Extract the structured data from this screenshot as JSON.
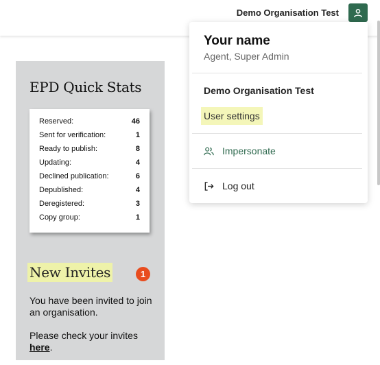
{
  "header": {
    "organisation": "Demo Organisation Test",
    "avatar_icon": "user-icon"
  },
  "stats": {
    "title": "EPD Quick Stats",
    "rows": [
      {
        "label": "Reserved:",
        "value": "46"
      },
      {
        "label": "Sent for verification:",
        "value": "1"
      },
      {
        "label": "Ready to publish:",
        "value": "8"
      },
      {
        "label": "Updating:",
        "value": "4"
      },
      {
        "label": "Declined publication:",
        "value": "6"
      },
      {
        "label": "Depublished:",
        "value": "4"
      },
      {
        "label": "Deregistered:",
        "value": "3"
      },
      {
        "label": "Copy group:",
        "value": "1"
      }
    ]
  },
  "invites": {
    "title": "New Invites",
    "count": "1",
    "message": "You have been invited to join an organisation.",
    "check_prefix": "Please check your invites",
    "link_text": "here",
    "check_suffix": "."
  },
  "menu": {
    "name": "Your name",
    "role": "Agent, Super Admin",
    "organisation": "Demo Organisation Test",
    "settings_label": "User settings",
    "impersonate_label": "Impersonate",
    "impersonate_icon": "users-icon",
    "logout_label": "Log out",
    "logout_icon": "logout-icon"
  },
  "colors": {
    "brand_green": "#2f6a4f",
    "badge_orange": "#e84c1e",
    "highlight_yellow": "#f4f6b9",
    "panel_gray": "#d6d7d8"
  }
}
